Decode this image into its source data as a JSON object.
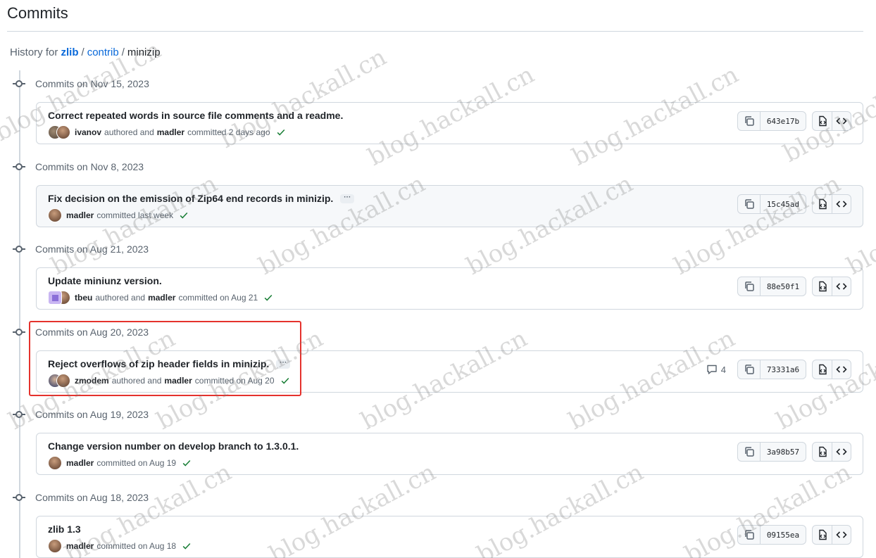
{
  "page": {
    "title": "Commits",
    "history_prefix": "History for",
    "breadcrumb": [
      "zlib",
      "contrib",
      "minizip"
    ],
    "breadcrumb_sep": "/"
  },
  "colors": {
    "link": "#0969da",
    "success": "#1a7f37",
    "highlight_box": "#e5322d"
  },
  "groups": [
    {
      "date": "Commits on Nov 15, 2023",
      "commit": {
        "message": "Correct repeated words in source file comments and a readme.",
        "has_ellipsis": false,
        "authors": [
          "ivanov",
          "madler"
        ],
        "author": "ivanov",
        "authored_text": "authored and",
        "committer": "madler",
        "committed_text": "committed 2 days ago",
        "sha": "643e17b",
        "comments": ""
      }
    },
    {
      "date": "Commits on Nov 8, 2023",
      "commit": {
        "message": "Fix decision on the emission of Zip64 end records in minizip.",
        "has_ellipsis": true,
        "authors": [
          "madler"
        ],
        "author": "madler",
        "authored_text": "",
        "committer": "",
        "committed_text": "committed last week",
        "sha": "15c45ad",
        "comments": ""
      }
    },
    {
      "date": "Commits on Aug 21, 2023",
      "commit": {
        "message": "Update miniunz version.",
        "has_ellipsis": false,
        "authors": [
          "tbeu",
          "madler"
        ],
        "author": "tbeu",
        "authored_text": "authored and",
        "committer": "madler",
        "committed_text": "committed on Aug 21",
        "sha": "88e50f1",
        "comments": ""
      }
    },
    {
      "date": "Commits on Aug 20, 2023",
      "commit": {
        "message": "Reject overflows of zip header fields in minizip.",
        "has_ellipsis": true,
        "authors": [
          "zmodem",
          "madler"
        ],
        "author": "zmodem",
        "authored_text": "authored and",
        "committer": "madler",
        "committed_text": "committed on Aug 20",
        "sha": "73331a6",
        "comments": "4"
      }
    },
    {
      "date": "Commits on Aug 19, 2023",
      "commit": {
        "message": "Change version number on develop branch to 1.3.0.1.",
        "has_ellipsis": false,
        "authors": [
          "madler"
        ],
        "author": "madler",
        "authored_text": "",
        "committer": "",
        "committed_text": "committed on Aug 19",
        "sha": "3a98b57",
        "comments": ""
      }
    },
    {
      "date": "Commits on Aug 18, 2023",
      "commit": {
        "message": "zlib 1.3",
        "has_ellipsis": false,
        "authors": [
          "madler"
        ],
        "author": "madler",
        "authored_text": "",
        "committer": "",
        "committed_text": "committed on Aug 18",
        "sha": "09155ea",
        "comments": ""
      }
    }
  ],
  "watermark_text": "blog.hackall.cn"
}
